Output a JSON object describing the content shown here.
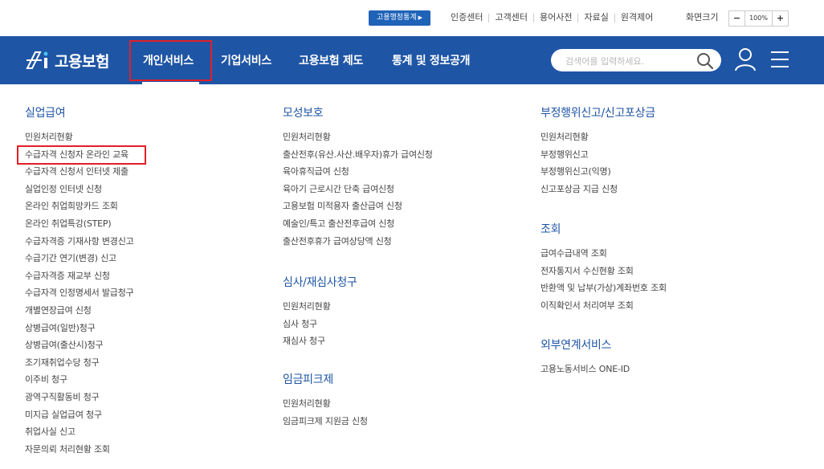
{
  "top": {
    "stats_button": "고용행정통계",
    "links": [
      "인증센터",
      "고객센터",
      "용어사전",
      "자료실",
      "원격제어"
    ],
    "zoom_label": "화면크기",
    "zoom_minus": "−",
    "zoom_value": "100%",
    "zoom_plus": "+"
  },
  "nav": {
    "logo_text": "고용보험",
    "menu": [
      "개인서비스",
      "기업서비스",
      "고용보험 제도",
      "통계 및 정보공개"
    ],
    "search_placeholder": "검색어를 입력하세요."
  },
  "columns": {
    "col1": {
      "title": "실업급여",
      "items": [
        "민원처리현황",
        "수급자격 신청자 온라인 교육",
        "수급자격 신청서 인터넷 제출",
        "실업인정 인터넷 신청",
        "온라인 취업희망카드 조회",
        "온라인 취업특강(STEP)",
        "수급자격증 기재사항 변경신고",
        "수급기간 연기(변경) 신고",
        "수급자격증 재교부 신청",
        "수급자격 인정명세서 발급청구",
        "개별연장급여 신청",
        "상병급여(일반)청구",
        "상병급여(출산시)청구",
        "조기재취업수당 청구",
        "이주비 청구",
        "광역구직활동비 청구",
        "미지급 실업급여 청구",
        "취업사실 신고",
        "자문의뢰 처리현황 조회"
      ]
    },
    "col2": [
      {
        "title": "모성보호",
        "items": [
          "민원처리현황",
          "출산전후(유산.사산.배우자)휴가 급여신청",
          "육아휴직급여 신청",
          "육아기 근로시간 단축 급여신청",
          "고용보험 미적용자 출산급여 신청",
          "예술인/특고 출산전후급여 신청",
          "출산전후휴가 급여상당액 신청"
        ]
      },
      {
        "title": "심사/재심사청구",
        "items": [
          "민원처리현황",
          "심사 청구",
          "재심사 청구"
        ]
      },
      {
        "title": "임금피크제",
        "items": [
          "민원처리현황",
          "임금피크제 지원금 신청"
        ]
      }
    ],
    "col3": [
      {
        "title": "부정행위신고/신고포상금",
        "items": [
          "민원처리현황",
          "부정행위신고",
          "부정행위신고(익명)",
          "신고포상금 지급 신청"
        ]
      },
      {
        "title": "조회",
        "items": [
          "급여수급내역 조회",
          "전자통지서 수신현황 조회",
          "반환액 및 납부(가상)계좌번호 조회",
          "이직확인서 처리여부 조회"
        ]
      },
      {
        "title": "외부연계서비스",
        "items": [
          "고용노동서비스 ONE-ID"
        ]
      }
    ]
  },
  "colors": {
    "nav_bg": "#1f55a5",
    "accent": "#e21f26",
    "title": "#1f55a5"
  }
}
